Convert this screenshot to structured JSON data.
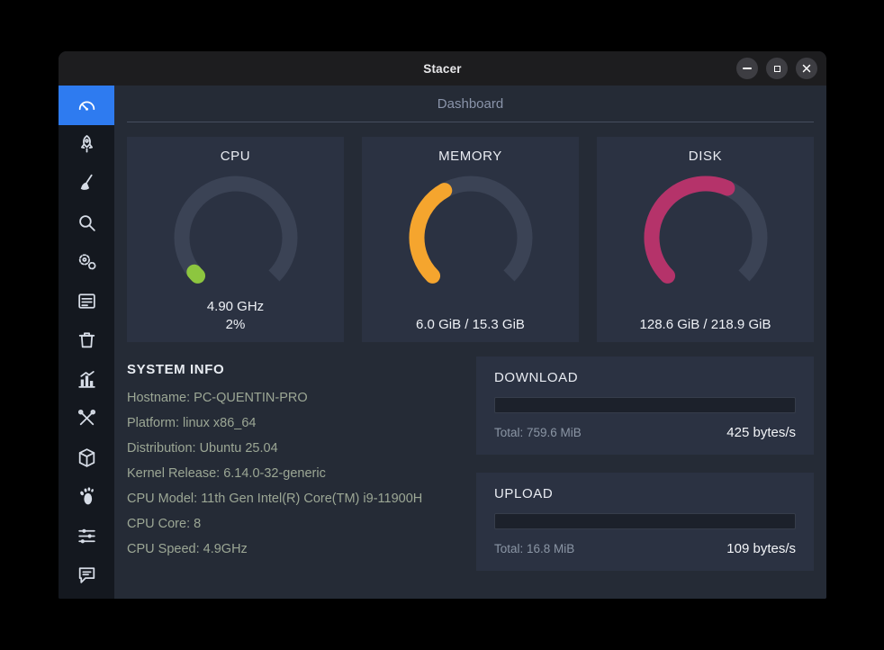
{
  "window": {
    "title": "Stacer"
  },
  "page": {
    "title": "Dashboard"
  },
  "colors": {
    "accent": "#2e7bf0"
  },
  "sidebar": {
    "items": [
      {
        "name": "dashboard",
        "active": true
      },
      {
        "name": "startup-apps",
        "active": false
      },
      {
        "name": "system-cleaner",
        "active": false
      },
      {
        "name": "search",
        "active": false
      },
      {
        "name": "services",
        "active": false
      },
      {
        "name": "processes",
        "active": false
      },
      {
        "name": "uninstaller",
        "active": false
      },
      {
        "name": "resources",
        "active": false
      },
      {
        "name": "helpers",
        "active": false
      },
      {
        "name": "apt-repository",
        "active": false
      },
      {
        "name": "gnome-settings",
        "active": false
      },
      {
        "name": "settings",
        "active": false
      },
      {
        "name": "feedback",
        "active": false
      }
    ]
  },
  "gauges": [
    {
      "title": "CPU",
      "line1": "4.90 GHz",
      "line2": "2%",
      "percent": 2,
      "color": "#8dc63f"
    },
    {
      "title": "MEMORY",
      "line1": "6.0 GiB / 15.3 GiB",
      "percent": 39.2,
      "color": "#f5a52e"
    },
    {
      "title": "DISK",
      "line1": "128.6 GiB / 218.9 GiB",
      "percent": 58.7,
      "color": "#b5336a"
    }
  ],
  "system_info": {
    "title": "SYSTEM INFO",
    "items": [
      "Hostname: PC-QUENTIN-PRO",
      "Platform: linux x86_64",
      "Distribution: Ubuntu 25.04",
      "Kernel Release: 6.14.0-32-generic",
      "CPU Model: 11th Gen Intel(R) Core(TM) i9-11900H",
      "CPU Core: 8",
      "CPU Speed: 4.9GHz"
    ]
  },
  "network": [
    {
      "title": "DOWNLOAD",
      "total": "Total: 759.6 MiB",
      "rate": "425 bytes/s",
      "progress": 0
    },
    {
      "title": "UPLOAD",
      "total": "Total: 16.8 MiB",
      "rate": "109 bytes/s",
      "progress": 0
    }
  ]
}
